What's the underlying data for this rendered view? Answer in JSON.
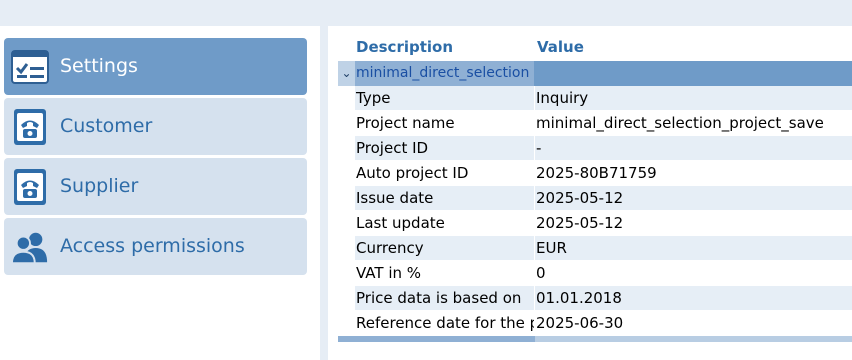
{
  "nav": {
    "items": [
      {
        "label": "Settings",
        "icon": "settings-checklist-icon",
        "active": true
      },
      {
        "label": "Customer",
        "icon": "phone-book-icon",
        "active": false
      },
      {
        "label": "Supplier",
        "icon": "phone-book-icon",
        "active": false
      },
      {
        "label": "Access permissions",
        "icon": "users-icon",
        "active": false
      }
    ]
  },
  "grid": {
    "headers": {
      "description": "Description",
      "value": "Value"
    },
    "group": {
      "label": "minimal_direct_selection",
      "expanded_icon": "chevron-down-icon"
    },
    "rows": [
      {
        "description": "Type",
        "value": "Inquiry"
      },
      {
        "description": "Project name",
        "value": "minimal_direct_selection_project_save"
      },
      {
        "description": "Project ID",
        "value": "-"
      },
      {
        "description": "Auto project ID",
        "value": "2025-80B71759"
      },
      {
        "description": "Issue date",
        "value": "2025-05-12"
      },
      {
        "description": "Last update",
        "value": "2025-05-12"
      },
      {
        "description": "Currency",
        "value": "EUR"
      },
      {
        "description": "VAT in %",
        "value": "0"
      },
      {
        "description": "Price data is based on",
        "value": "01.01.2018"
      },
      {
        "description": "Reference date for the pr",
        "value": "2025-06-30"
      }
    ]
  },
  "colors": {
    "accent": "#2e6ca8",
    "active_nav": "#6f9bc8",
    "nav_bg": "#d5e1ee",
    "row_alt": "#e6eef6",
    "group_bar": "#6f9bc8"
  }
}
